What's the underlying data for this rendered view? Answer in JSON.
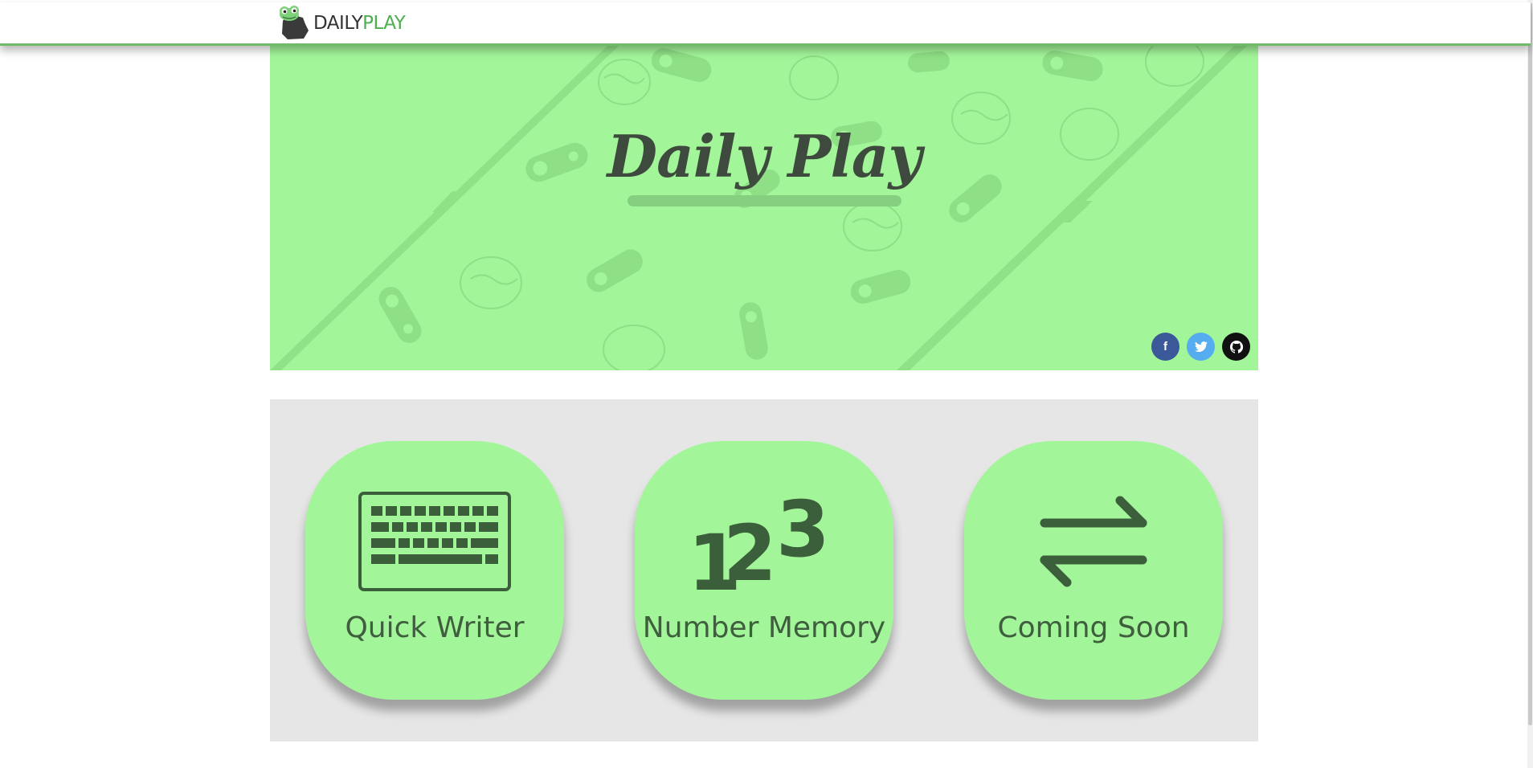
{
  "header": {
    "brand_part1": "DAILY",
    "brand_part2": "PLAY",
    "logo_icon": "frog-logo-icon"
  },
  "hero": {
    "title": "Daily Play",
    "background_color": "#a3f59a",
    "social": [
      {
        "name": "facebook",
        "glyph": "f",
        "color": "#3b5998"
      },
      {
        "name": "twitter",
        "glyph": "t",
        "color": "#55acee"
      },
      {
        "name": "github",
        "glyph": "gh",
        "color": "#111111"
      }
    ]
  },
  "games": [
    {
      "label": "Quick Writer",
      "icon": "keyboard-icon"
    },
    {
      "label": "Number Memory",
      "icon": "numbers-123-icon"
    },
    {
      "label": "Coming Soon",
      "icon": "swap-arrows-icon"
    }
  ],
  "colors": {
    "accent_green": "#a3f59a",
    "brand_green": "#4caf50",
    "panel_gray": "#e6e6e6",
    "icon_dark_green": "#3b5e3b"
  }
}
